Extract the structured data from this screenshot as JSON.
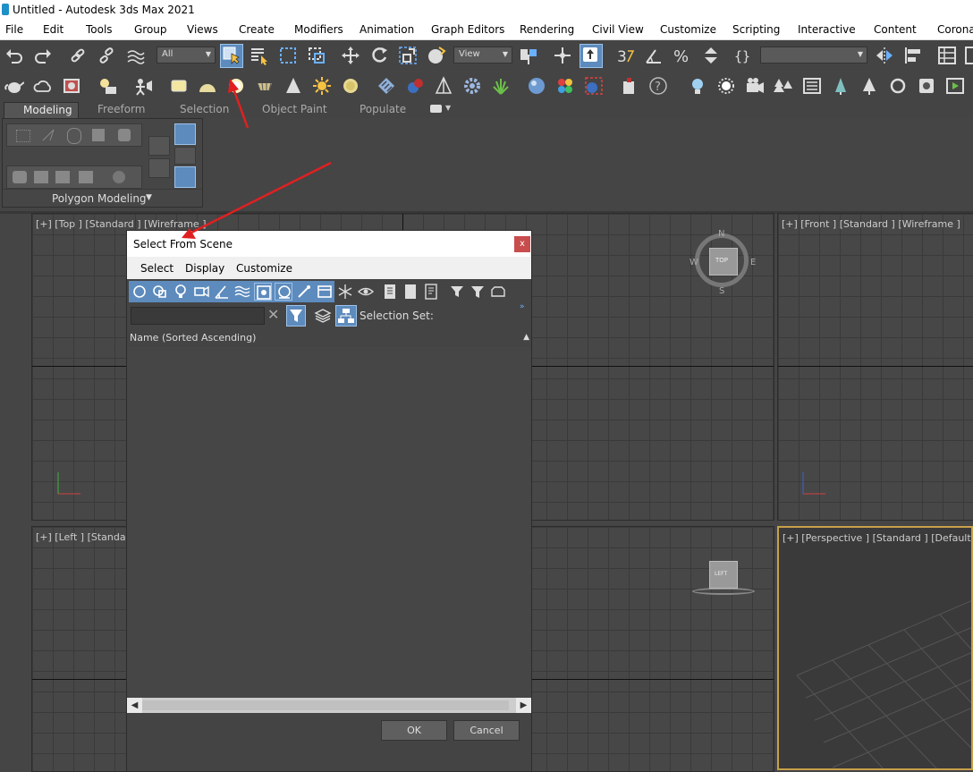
{
  "window": {
    "title": "Untitled - Autodesk 3ds Max 2021"
  },
  "menu": [
    "File",
    "Edit",
    "Tools",
    "Group",
    "Views",
    "Create",
    "Modifiers",
    "Animation",
    "Graph Editors",
    "Rendering",
    "Civil View",
    "Customize",
    "Scripting",
    "Interactive",
    "Content",
    "Corona"
  ],
  "toolbar": {
    "filter_dropdown": "All",
    "refcoord_dropdown": "View",
    "named_selection_dropdown": ""
  },
  "ribbon": {
    "tabs": [
      "Modeling",
      "Freeform",
      "Selection",
      "Object Paint",
      "Populate"
    ],
    "active_tab": "Modeling",
    "panel_label": "Polygon Modeling"
  },
  "viewports": {
    "top": {
      "label": "[+] [Top ] [Standard ] [Wireframe ]",
      "viewcube": "TOP",
      "compass": {
        "n": "N",
        "s": "S",
        "e": "E",
        "w": "W"
      }
    },
    "front": {
      "label": "[+] [Front ] [Standard ] [Wireframe ]"
    },
    "left": {
      "label": "[+] [Left ] [Standar",
      "viewcube": "LEFT"
    },
    "perspective": {
      "label": "[+] [Perspective ] [Standard ] [Default Sha"
    }
  },
  "dialog": {
    "title": "Select From Scene",
    "close": "x",
    "menu": [
      "Select",
      "Display",
      "Customize"
    ],
    "search_value": "",
    "selection_set_label": "Selection Set:",
    "column_header": "Name (Sorted Ascending)",
    "ok": "OK",
    "cancel": "Cancel"
  },
  "colors": {
    "accent": "#5d8bbd",
    "annotation": "#e02020",
    "active_viewport": "#c8a04a"
  }
}
